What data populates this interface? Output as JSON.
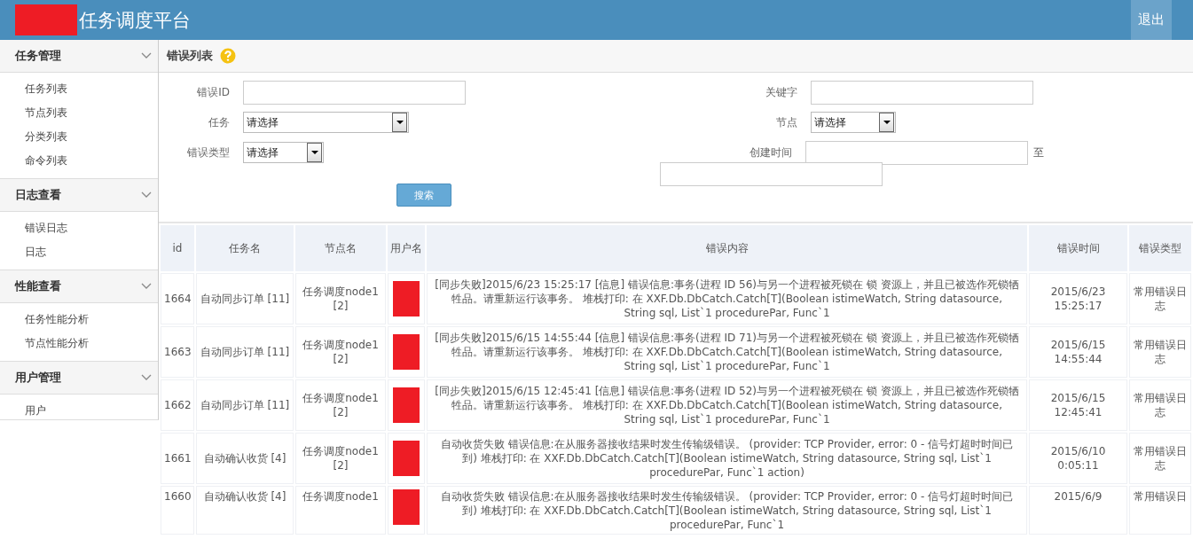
{
  "header": {
    "title": "任务调度平台",
    "logout": "退出"
  },
  "sidebar": {
    "groups": [
      {
        "label": "任务管理",
        "expanded": true,
        "items": [
          "任务列表",
          "节点列表",
          "分类列表",
          "命令列表"
        ]
      },
      {
        "label": "日志查看",
        "expanded": true,
        "items": [
          "错误日志",
          "日志"
        ]
      },
      {
        "label": "性能查看",
        "expanded": true,
        "items": [
          "任务性能分析",
          "节点性能分析"
        ]
      },
      {
        "label": "用户管理",
        "expanded": true,
        "items": [
          "用户"
        ]
      }
    ]
  },
  "page_title": "错误列表",
  "filters": {
    "error_id": {
      "label": "错误ID"
    },
    "keyword": {
      "label": "关键字"
    },
    "task": {
      "label": "任务",
      "value": "请选择"
    },
    "node": {
      "label": "节点",
      "value": "请选择"
    },
    "error_type": {
      "label": "错误类型",
      "value": "请选择"
    },
    "created": {
      "label": "创建时间",
      "separator": "至"
    },
    "search_button": "搜索"
  },
  "table": {
    "columns": [
      "id",
      "任务名",
      "节点名",
      "用户名",
      "错误内容",
      "错误时间",
      "错误类型"
    ],
    "rows": [
      {
        "id": "1664",
        "task": "自动同步订单 [11]",
        "node": "任务调度node1 [2]",
        "content": "[同步失败]2015/6/23 15:25:17 [信息] 错误信息:事务(进程 ID 56)与另一个进程被死锁在 锁 资源上，并且已被选作死锁牺牲品。请重新运行该事务。 堆栈打印: 在 XXF.Db.DbCatch.Catch[T](Boolean istimeWatch, String datasource, String sql, List`1 procedurePar, Func`1",
        "time": "2015/6/23 15:25:17",
        "type": "常用错误日志"
      },
      {
        "id": "1663",
        "task": "自动同步订单 [11]",
        "node": "任务调度node1 [2]",
        "content": "[同步失败]2015/6/15 14:55:44 [信息] 错误信息:事务(进程 ID 71)与另一个进程被死锁在 锁 资源上，并且已被选作死锁牺牲品。请重新运行该事务。 堆栈打印: 在 XXF.Db.DbCatch.Catch[T](Boolean istimeWatch, String datasource, String sql, List`1 procedurePar, Func`1",
        "time": "2015/6/15 14:55:44",
        "type": "常用错误日志"
      },
      {
        "id": "1662",
        "task": "自动同步订单 [11]",
        "node": "任务调度node1 [2]",
        "content": "[同步失败]2015/6/15 12:45:41 [信息] 错误信息:事务(进程 ID 52)与另一个进程被死锁在 锁 资源上，并且已被选作死锁牺牲品。请重新运行该事务。 堆栈打印: 在 XXF.Db.DbCatch.Catch[T](Boolean istimeWatch, String datasource, String sql, List`1 procedurePar, Func`1",
        "time": "2015/6/15 12:45:41",
        "type": "常用错误日志"
      },
      {
        "id": "1661",
        "task": "自动确认收货 [4]",
        "node": "任务调度node1 [2]",
        "content": "自动收货失败 错误信息:在从服务器接收结果时发生传输级错误。 (provider: TCP Provider, error: 0 - 信号灯超时时间已到) 堆栈打印: 在 XXF.Db.DbCatch.Catch[T](Boolean istimeWatch, String datasource, String sql, List`1 procedurePar, Func`1 action)",
        "time": "2015/6/10 0:05:11",
        "type": "常用错误日志"
      },
      {
        "id": "1660",
        "task": "自动确认收货 [4]",
        "node": "任务调度node1",
        "content": "自动收货失败 错误信息:在从服务器接收结果时发生传输级错误。 (provider: TCP Provider, error: 0 - 信号灯超时时间已到) 堆栈打印: 在 XXF.Db.DbCatch.Catch[T](Boolean istimeWatch, String datasource, String sql, List`1 procedurePar, Func`1",
        "time": "2015/6/9",
        "type": "常用错误日"
      }
    ]
  }
}
